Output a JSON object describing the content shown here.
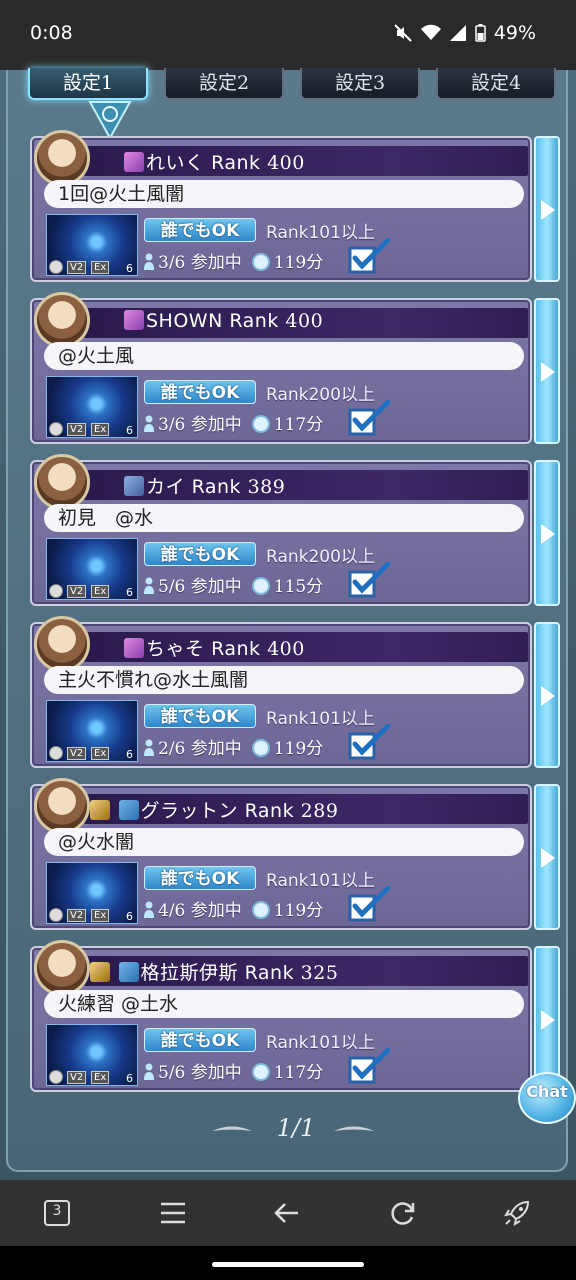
{
  "status_bar": {
    "time": "0:08",
    "battery": "49%"
  },
  "tabs": [
    {
      "label": "設定1",
      "active": true
    },
    {
      "label": "設定2",
      "active": false
    },
    {
      "label": "設定3",
      "active": false
    },
    {
      "label": "設定4",
      "active": false
    }
  ],
  "rooms": [
    {
      "name": "れいく",
      "rank_label": "Rank",
      "rank": "400",
      "comment": "1回@火土風闇",
      "join_label": "誰でもOK",
      "requirement": "Rank101以上",
      "participants": "3/6",
      "status": "参加中",
      "time_left": "119分"
    },
    {
      "name": "SHOWN",
      "rank_label": "Rank",
      "rank": "400",
      "comment": "@火土風",
      "join_label": "誰でもOK",
      "requirement": "Rank200以上",
      "participants": "3/6",
      "status": "参加中",
      "time_left": "117分"
    },
    {
      "name": "カイ",
      "rank_label": "Rank",
      "rank": "389",
      "comment": "初見　@水",
      "join_label": "誰でもOK",
      "requirement": "Rank200以上",
      "participants": "5/6",
      "status": "参加中",
      "time_left": "115分"
    },
    {
      "name": "ちゃそ",
      "rank_label": "Rank",
      "rank": "400",
      "comment": "主火不慣れ@水土風闇",
      "join_label": "誰でもOK",
      "requirement": "Rank101以上",
      "participants": "2/6",
      "status": "参加中",
      "time_left": "119分"
    },
    {
      "name": "グラットン",
      "rank_label": "Rank",
      "rank": "289",
      "comment": "@火水闇",
      "join_label": "誰でもOK",
      "requirement": "Rank101以上",
      "participants": "4/6",
      "status": "参加中",
      "time_left": "119分"
    },
    {
      "name": "格拉斯伊斯",
      "rank_label": "Rank",
      "rank": "325",
      "comment": "火練習 @土水",
      "join_label": "誰でもOK",
      "requirement": "Rank101以上",
      "participants": "5/6",
      "status": "参加中",
      "time_left": "117分"
    }
  ],
  "thumb_labels": {
    "v2": "V2",
    "ex": "Ex",
    "count": "6"
  },
  "pager": {
    "text": "1/1"
  },
  "chat_button": "Chat",
  "toolbar": {
    "tabs_count": "3"
  },
  "colors": {
    "accent": "#5ac0e8",
    "namebar": "#2a1a4c",
    "card": "#7e78a8"
  }
}
